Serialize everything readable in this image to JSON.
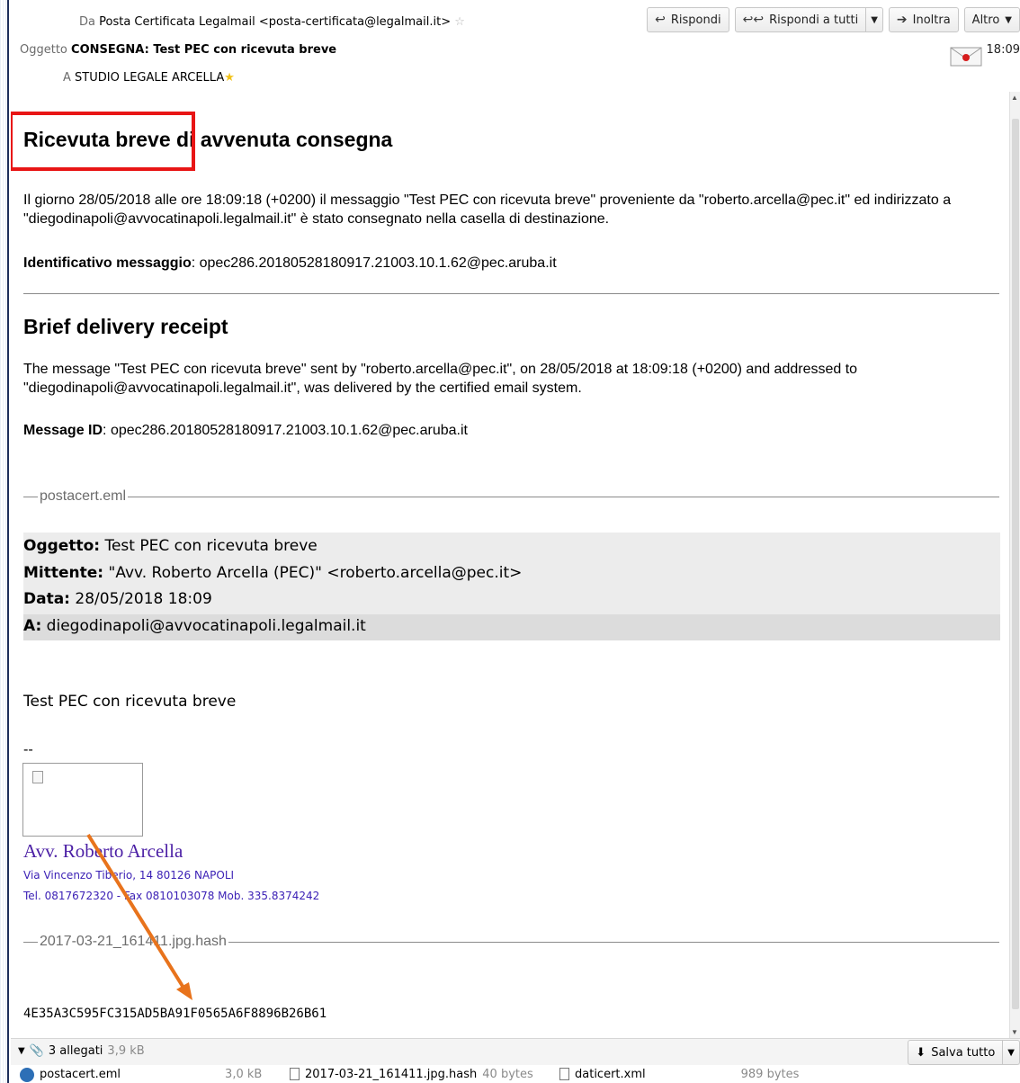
{
  "header": {
    "from_label": "Da",
    "from_value": "Posta Certificata Legalmail <posta-certificata@legalmail.it>",
    "subject_label": "Oggetto",
    "subject_value": "CONSEGNA: Test PEC con ricevuta breve",
    "to_label": "A",
    "to_value": "STUDIO LEGALE ARCELLA",
    "time": "18:09",
    "toolbar": {
      "reply": "Rispondi",
      "reply_all": "Rispondi a tutti",
      "forward": "Inoltra",
      "more": "Altro"
    }
  },
  "message": {
    "title_it": "Ricevuta breve di avvenuta consegna",
    "body_it": "Il giorno 28/05/2018 alle ore 18:09:18 (+0200) il messaggio \"Test PEC con ricevuta breve\" proveniente da \"roberto.arcella@pec.it\" ed indirizzato a \"diegodinapoli@avvocatinapoli.legalmail.it\" è stato consegnato nella casella di destinazione.",
    "id_label_it": "Identificativo messaggio",
    "id_value": ": opec286.20180528180917.21003.10.1.62@pec.aruba.it",
    "title_en": "Brief delivery receipt",
    "body_en": "The message \"Test PEC con ricevuta breve\" sent by \"roberto.arcella@pec.it\", on 28/05/2018 at 18:09:18 (+0200) and addressed to \"diegodinapoli@avvocatinapoli.legalmail.it\", was delivered by the certified email system.",
    "id_label_en": "Message ID",
    "id_value_en": ": opec286.20180528180917.21003.10.1.62@pec.aruba.it",
    "sep1": "postacert.eml",
    "meta": {
      "subject_label": "Oggetto:",
      "subject_value": " Test PEC con ricevuta breve",
      "sender_label": "Mittente:",
      "sender_value": " \"Avv. Roberto Arcella (PEC)\" <roberto.arcella@pec.it>",
      "date_label": "Data:",
      "date_value": " 28/05/2018 18:09",
      "to_label": "A:",
      "to_value": " diegodinapoli@avvocatinapoli.legalmail.it"
    },
    "plain_body": "Test PEC con ricevuta breve",
    "sig_dashes": "--",
    "sig_name": "Avv. Roberto Arcella",
    "sig_address": "Via Vincenzo Tiberio, 14 80126 NAPOLI",
    "sig_phone": "Tel. 0817672320 - Fax 0810103078 Mob. 335.8374242",
    "sep2": "2017-03-21_161411.jpg.hash",
    "hash": "4E35A3C595FC315AD5BA91F0565A6F8896B26B61"
  },
  "attachments": {
    "summary": "3 allegati",
    "total_size": "3,9 kB",
    "save_all": "Salva tutto",
    "files": [
      {
        "name": "postacert.eml",
        "size": "3,0 kB"
      },
      {
        "name": "2017-03-21_161411.jpg.hash",
        "size": "40 bytes"
      },
      {
        "name": "daticert.xml",
        "size": "989 bytes"
      }
    ]
  },
  "colors": {
    "highlight_box": "#e81515",
    "annotation_arrow": "#e8731c",
    "signature": "#4b1fa5"
  }
}
